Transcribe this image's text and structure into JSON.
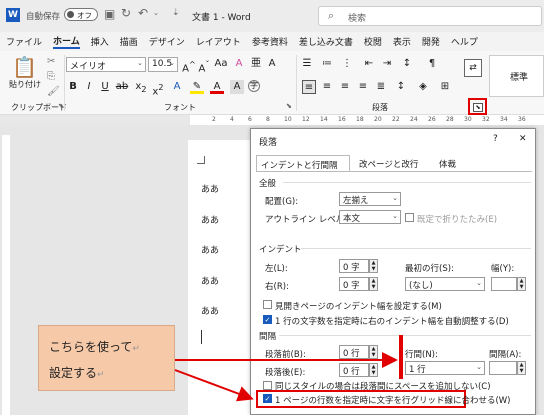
{
  "titlebar": {
    "autosave": "自動保存",
    "toggle": "オフ",
    "doc_title": "文書 1 - Word",
    "search_placeholder": "検索"
  },
  "menu": [
    "ファイル",
    "ホーム",
    "挿入",
    "描画",
    "デザイン",
    "レイアウト",
    "参考資料",
    "差し込み文書",
    "校閲",
    "表示",
    "開発",
    "ヘルプ"
  ],
  "ribbon": {
    "paste": "貼り付け",
    "clipboard": "クリップボード",
    "font_name": "メイリオ",
    "font_size": "10.5",
    "font_group": "フォント",
    "para_group": "段落",
    "style_preview": "標準"
  },
  "ruler_ticks": [
    "2",
    "4",
    "6",
    "8",
    "10",
    "12",
    "14",
    "16",
    "18",
    "20",
    "22",
    "24",
    "26",
    "28",
    "30",
    "32",
    "34",
    "36"
  ],
  "document_lines": [
    "ああ",
    "ああ",
    "ああ",
    "ああ",
    "ああ"
  ],
  "dialog": {
    "title": "段落",
    "help": "?",
    "close": "✕",
    "tabs": [
      "インデントと行間隔",
      "改ページと改行",
      "体裁"
    ],
    "general_heading": "全般",
    "alignment_label": "配置(G):",
    "alignment_value": "左揃え",
    "outline_label": "アウトライン レベル(O):",
    "outline_value": "本文",
    "collapsed_label": "既定で折りたたみ(E)",
    "indent_heading": "インデント",
    "left_label": "左(L):",
    "left_value": "0 字",
    "right_label": "右(R):",
    "right_value": "0 字",
    "first_line_label": "最初の行(S):",
    "first_line_value": "(なし)",
    "width_label": "幅(Y):",
    "mirror_label": "見開きページのインデント幅を設定する(M)",
    "auto_indent_label": "1 行の文字数を指定時に右のインデント幅を自動調整する(D)",
    "spacing_heading": "間隔",
    "before_label": "段落前(B):",
    "before_value": "0 行",
    "after_label": "段落後(E):",
    "after_value": "0 行",
    "line_spacing_label": "行間(N):",
    "line_spacing_value": "1 行",
    "at_label": "間隔(A):",
    "same_style_label": "同じスタイルの場合は段落間にスペースを追加しない(C)",
    "grid_label": "1 ページの行数を指定時に文字を行グリッド線に合わせる(W)"
  },
  "callout": {
    "line1": "こちらを使って",
    "line2": "設定する"
  },
  "colors": {
    "accent": "#185abd",
    "highlight": "#e00000",
    "callout_bg": "#f6c9a8"
  }
}
